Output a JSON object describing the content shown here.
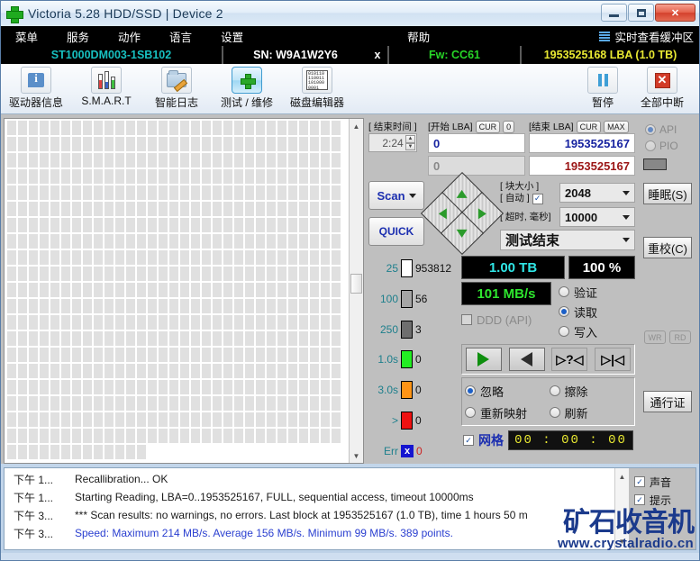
{
  "window": {
    "title": "Victoria 5.28 HDD/SSD | Device 2",
    "minimize": "–",
    "maximize": "□",
    "close": "✕"
  },
  "menu": {
    "items": [
      "菜单",
      "服务",
      "动作",
      "语言",
      "设置",
      "帮助"
    ],
    "buffer_view": "实时查看缓冲区",
    "buffer_icon": "list-icon"
  },
  "device": {
    "model": "ST1000DM003-1SB102",
    "serial": "SN: W9A1W2Y6",
    "x_button": "x",
    "firmware": "Fw: CC61",
    "capacity": "1953525168 LBA (1.0 TB)"
  },
  "toolbar": {
    "items": [
      {
        "label": "驱动器信息",
        "icon": "info-icon"
      },
      {
        "label": "S.M.A.R.T",
        "icon": "smart-bars-icon"
      },
      {
        "label": "智能日志",
        "icon": "folder-pencil-icon"
      },
      {
        "label": "测试 / 维修",
        "icon": "green-cross-icon"
      },
      {
        "label": "磁盘编辑器",
        "icon": "hex-page-icon"
      }
    ],
    "right_items": [
      {
        "label": "暂停",
        "icon": "pause-icon"
      },
      {
        "label": "全部中断",
        "icon": "stop-icon"
      }
    ],
    "hex_lines": [
      "010110",
      "110011",
      "101000",
      "0001"
    ]
  },
  "scan_grid": {
    "full_rows": 19,
    "cols": 33,
    "partial_last_row": 6,
    "cell_color": "#e0e0e0"
  },
  "controls": {
    "end_time_label": "[ 结束时间 ]",
    "end_time_value": "2:24",
    "start_lba_label": "[开始 LBA]",
    "start_lba_cur": "CUR",
    "start_lba_zero": "0",
    "start_lba_value": "0",
    "start_lba_value2": "0",
    "end_lba_label": "[结束 LBA]",
    "end_lba_cur": "CUR",
    "end_lba_max": "MAX",
    "end_lba_value": "1953525167",
    "end_lba_value2": "1953525167",
    "scan_button": "Scan",
    "quick_button": "QUICK",
    "block_size_label": "[ 块大小 ]",
    "auto_label": "[ 自动 ]",
    "auto_checked": "✓",
    "block_size_value": "2048",
    "timeout_label": "[ 超时, 毫秒]",
    "timeout_value": "10000",
    "test_mode_value": "测试结束",
    "dpad": [
      "up-arrow-icon",
      "down-arrow-icon",
      "left-arrow-icon",
      "right-arrow-icon"
    ]
  },
  "stats": {
    "rows": [
      {
        "name": "25",
        "color": "#ffffff",
        "value": "953812"
      },
      {
        "name": "100",
        "color": "#a6a6a6",
        "value": "56"
      },
      {
        "name": "250",
        "color": "#6e6e6e",
        "value": "3"
      },
      {
        "name": "1.0s",
        "color": "#22ee22",
        "value": "0"
      },
      {
        "name": "3.0s",
        "color": "#ff9416",
        "value": "0"
      },
      {
        "name": ">",
        "color": "#ee1111",
        "value": "0"
      },
      {
        "name": "Err",
        "color": "#1515d0",
        "value": "0"
      }
    ],
    "err_glyph": "x"
  },
  "readout": {
    "capacity": "1.00 TB",
    "percent": "100   %",
    "speed": "101 MB/s",
    "ddd_label": "DDD (API)",
    "modes": [
      {
        "label": "验证",
        "selected": false
      },
      {
        "label": "读取",
        "selected": true
      },
      {
        "label": "写入",
        "selected": false
      }
    ],
    "transport": [
      "play-icon",
      "reverse-icon",
      "step-question-icon",
      "skip-end-icon"
    ],
    "actions": [
      {
        "label": "忽略",
        "selected": true
      },
      {
        "label": "擦除",
        "selected": false
      },
      {
        "label": "重新映射",
        "selected": false
      },
      {
        "label": "刷新",
        "selected": false
      }
    ],
    "grid_label": "网格",
    "grid_checked": "✓",
    "timer": "00 : 00 : 00"
  },
  "side_panel": {
    "api_label": "API",
    "pio_label": "PIO",
    "api_selected": true,
    "pio_selected": false,
    "sleep_button": "睡眠(S)",
    "recal_button": "重校(C)",
    "wr_label": "WR",
    "rd_label": "RD",
    "pass_button": "通行证"
  },
  "log": {
    "rows": [
      {
        "time": "下午 1...",
        "message": "Recallibration... OK",
        "highlight": false
      },
      {
        "time": "下午 1...",
        "message": "Starting Reading, LBA=0..1953525167, FULL, sequential access, timeout 10000ms",
        "highlight": false
      },
      {
        "time": "下午 3...",
        "message": "*** Scan results: no warnings, no errors. Last block at 1953525167 (1.0 TB), time 1 hours 50 m",
        "highlight": false
      },
      {
        "time": "下午 3...",
        "message": "Speed: Maximum 214 MB/s. Average 156 MB/s. Minimum 99 MB/s. 389 points.",
        "highlight": true
      }
    ],
    "checkboxes": [
      {
        "label": "声音",
        "checked": "✓"
      },
      {
        "label": "提示",
        "checked": "✓"
      }
    ]
  },
  "watermark": {
    "line1": "矿石收音机",
    "line2": "www.crystalradio.cn"
  }
}
